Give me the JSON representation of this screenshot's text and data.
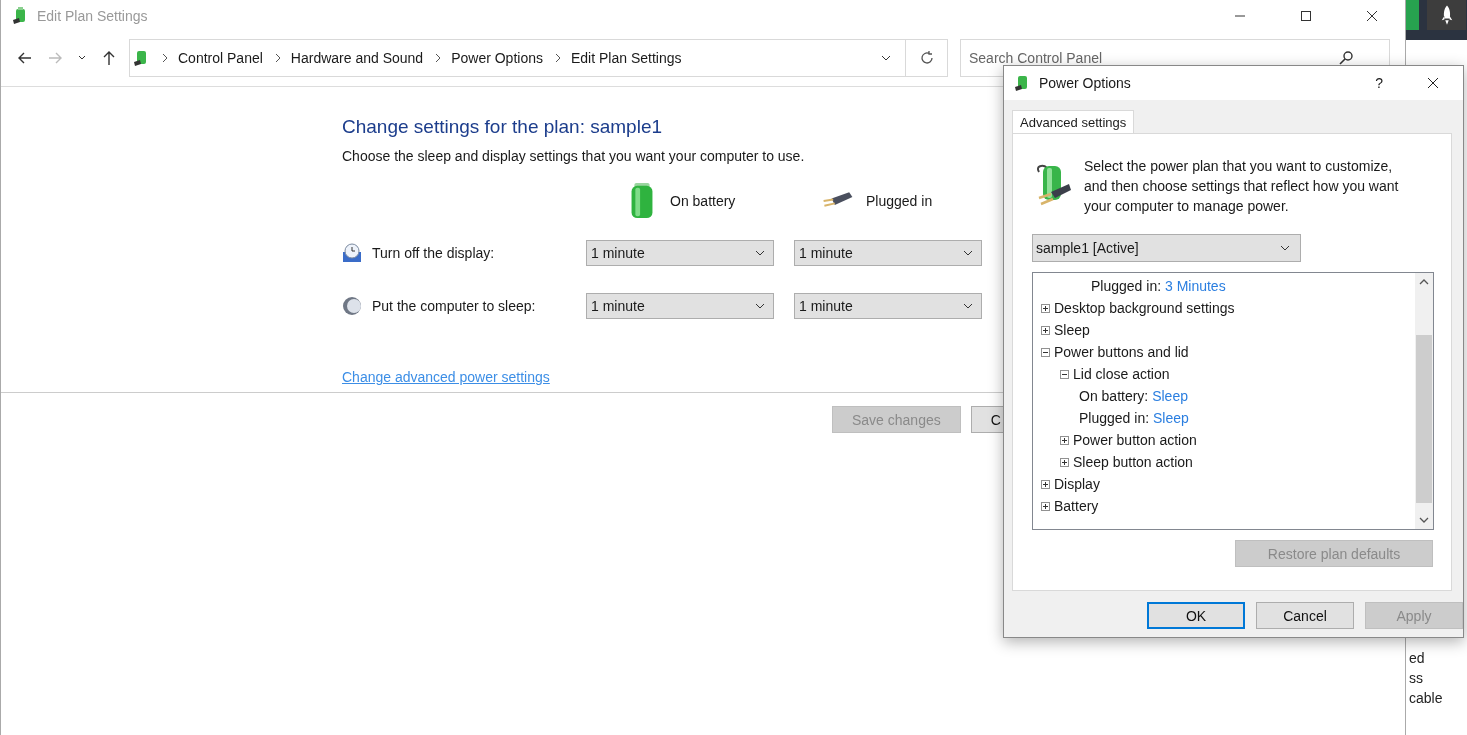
{
  "main_window": {
    "title": "Edit Plan Settings",
    "breadcrumb": [
      "Control Panel",
      "Hardware and Sound",
      "Power Options",
      "Edit Plan Settings"
    ],
    "search": {
      "placeholder": "Search Control Panel"
    },
    "heading": "Change settings for the plan: sample1",
    "subtitle": "Choose the sleep and display settings that you want your computer to use.",
    "columns": [
      {
        "label": "On battery",
        "kind": "battery"
      },
      {
        "label": "Plugged in",
        "kind": "plug"
      }
    ],
    "settings": [
      {
        "label": "Turn off the display:",
        "kind": "display",
        "values": [
          "1 minute",
          "1 minute"
        ]
      },
      {
        "label": "Put the computer to sleep:",
        "kind": "sleep",
        "values": [
          "1 minute",
          "1 minute"
        ]
      }
    ],
    "advanced_link": "Change advanced power settings",
    "buttons": [
      {
        "label": "Save changes",
        "disabled": true
      },
      {
        "label": "C",
        "disabled": false
      }
    ]
  },
  "dialog": {
    "title": "Power Options",
    "help": "?",
    "tabs": [
      {
        "label": "Advanced settings",
        "selected": true
      }
    ],
    "intro": "Select the power plan that you want to customize, and then choose settings that reflect how you want your computer to manage power.",
    "plan_select": "sample1 [Active]",
    "tree_top": {
      "label": "Plugged in:",
      "value": "3 Minutes"
    },
    "tree": [
      {
        "label": "Desktop background settings",
        "expanded": false
      },
      {
        "label": "Sleep",
        "expanded": false
      },
      {
        "label": "Power buttons and lid",
        "expanded": true,
        "children": [
          {
            "label": "Lid close action",
            "expanded": true,
            "children": [
              {
                "label": "On battery:",
                "value": "Sleep"
              },
              {
                "label": "Plugged in:",
                "value": "Sleep"
              }
            ]
          },
          {
            "label": "Power button action",
            "expanded": false
          },
          {
            "label": "Sleep button action",
            "expanded": false
          }
        ]
      },
      {
        "label": "Display",
        "expanded": false
      },
      {
        "label": "Battery",
        "expanded": false
      }
    ],
    "restore_button": {
      "label": "Restore plan defaults",
      "disabled": true
    },
    "buttons": [
      {
        "label": "OK",
        "default": true,
        "disabled": false
      },
      {
        "label": "Cancel",
        "default": false,
        "disabled": false
      },
      {
        "label": "Apply",
        "default": false,
        "disabled": true
      }
    ]
  },
  "background_fragments": [
    "ed",
    "ss",
    "cable"
  ]
}
